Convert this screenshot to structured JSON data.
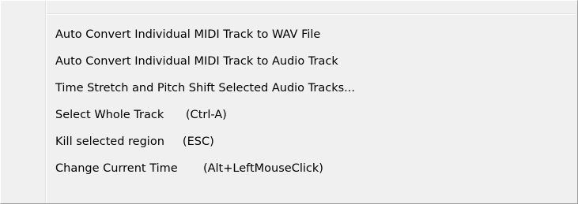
{
  "menu": {
    "items": [
      {
        "label": "Auto Convert Individual MIDI Track to WAV File"
      },
      {
        "label": "Auto Convert Individual MIDI Track to Audio Track"
      },
      {
        "label": "Time Stretch and Pitch Shift Selected Audio Tracks..."
      },
      {
        "label": "Select Whole Track      (Ctrl-A)"
      },
      {
        "label": "Kill selected region     (ESC)"
      },
      {
        "label": "Change Current Time       (Alt+LeftMouseClick)"
      }
    ]
  }
}
